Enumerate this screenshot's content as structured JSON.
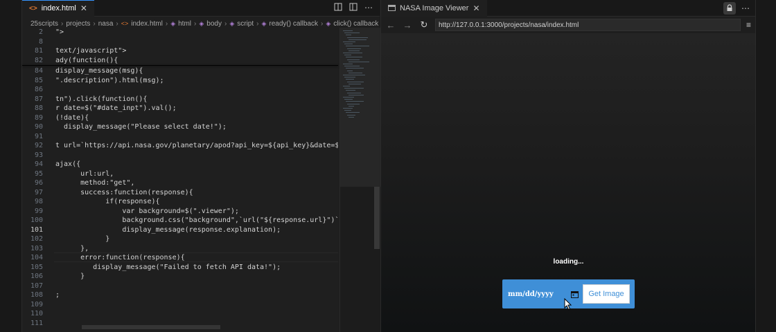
{
  "editor": {
    "tab_label": "index.html",
    "tab_icon_glyph": "<>",
    "breadcrumb": [
      "25scripts",
      "projects",
      "nasa",
      "index.html",
      "html",
      "body",
      "script",
      "ready() callback",
      "click() callback"
    ],
    "lines": [
      {
        "n": "2",
        "t": "\">"
      },
      {
        "n": "8",
        "t": ""
      },
      {
        "n": "81",
        "t": "text/javascript\">"
      },
      {
        "n": "82",
        "t": "ady(function(){"
      },
      {
        "n": "84",
        "t": "display_message(msg){"
      },
      {
        "n": "85",
        "t": "\".description\").html(msg);"
      },
      {
        "n": "86",
        "t": ""
      },
      {
        "n": "87",
        "t": "tn\").click(function(){"
      },
      {
        "n": "88",
        "t": "r date=$(\"#date_inpt\").val();"
      },
      {
        "n": "89",
        "t": "(!date){"
      },
      {
        "n": "90",
        "t": "  display_message(\"Please select date!\");"
      },
      {
        "n": "91",
        "t": ""
      },
      {
        "n": "92",
        "t": "t url=`https://api.nasa.gov/planetary/apod?api_key=${api_key}&date=${date}`"
      },
      {
        "n": "93",
        "t": ""
      },
      {
        "n": "94",
        "t": "ajax({"
      },
      {
        "n": "95",
        "t": "      url:url,"
      },
      {
        "n": "96",
        "t": "      method:\"get\","
      },
      {
        "n": "97",
        "t": "      success:function(response){"
      },
      {
        "n": "98",
        "t": "            if(response){"
      },
      {
        "n": "99",
        "t": "                var background=$(\".viewer\");"
      },
      {
        "n": "100",
        "t": "                background.css(\"background\",`url(\"${response.url}\")`);"
      },
      {
        "n": "101",
        "t": "                display_message(response.explanation);"
      },
      {
        "n": "102",
        "t": "            }"
      },
      {
        "n": "103",
        "t": "      },"
      },
      {
        "n": "104",
        "t": "      error:function(response){"
      },
      {
        "n": "105",
        "t": "         display_message(\"Failed to fetch API data!\");"
      },
      {
        "n": "106",
        "t": "      }"
      },
      {
        "n": "107",
        "t": ""
      },
      {
        "n": "108",
        "t": ";"
      },
      {
        "n": "109",
        "t": ""
      },
      {
        "n": "110",
        "t": ""
      },
      {
        "n": "111",
        "t": ""
      }
    ],
    "active_line": "101"
  },
  "browser": {
    "tab_label": "NASA Image Viewer",
    "url": "http://127.0.0.1:3000/projects/nasa/index.html",
    "page": {
      "status_text": "loading...",
      "date_placeholder": "mm/dd/yyyy",
      "button_label": "Get Image"
    }
  },
  "icons": {
    "lock": "lock-icon",
    "calendar": "calendar-icon",
    "menu": "hamburger-menu-icon"
  },
  "colors": {
    "accent_blue": "#3f8fd7",
    "tab_active_border": "#3794ff"
  }
}
